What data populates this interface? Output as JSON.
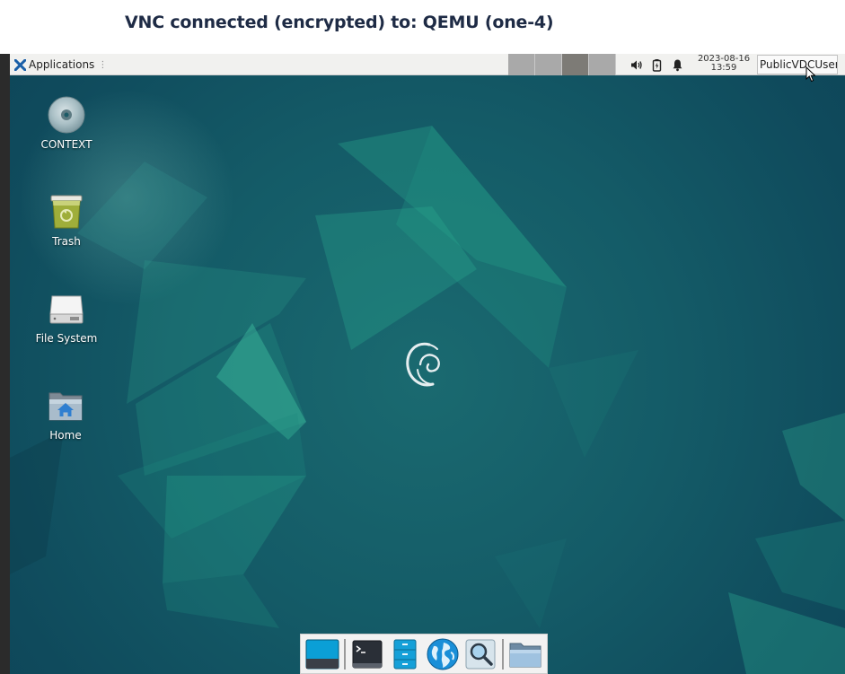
{
  "vnc": {
    "title": "VNC connected (encrypted) to: QEMU (one-4)"
  },
  "panel": {
    "applications_label": "Applications",
    "handle": "⋮",
    "workspaces": [
      {
        "name": "workspace-1",
        "active": false
      },
      {
        "name": "workspace-2",
        "active": false
      },
      {
        "name": "workspace-3",
        "active": true
      },
      {
        "name": "workspace-4",
        "active": false
      }
    ],
    "tray_icons": [
      "volume-icon",
      "battery-icon",
      "notification-bell-icon"
    ],
    "clock_date": "2023-08-16",
    "clock_time": "13:59",
    "user": "PublicVDCUser"
  },
  "desktop": {
    "icons": [
      {
        "name": "CONTEXT",
        "icon": "cd-icon"
      },
      {
        "name": "Trash",
        "icon": "trash-icon"
      },
      {
        "name": "File System",
        "icon": "drive-icon"
      },
      {
        "name": "Home",
        "icon": "home-folder-icon"
      }
    ]
  },
  "dock": {
    "items": [
      "show-desktop-icon",
      "terminal-icon",
      "file-manager-icon",
      "web-browser-icon",
      "app-finder-icon",
      "folder-icon"
    ]
  },
  "colors": {
    "vnc_title": "#1e2b45",
    "wallpaper_base": "#0f4a5c",
    "wallpaper_accent": "#22a88a",
    "panel_bg": "#f1f1ef",
    "workspace_active": "#7d7b76",
    "workspace_inactive": "#a9a9a9"
  }
}
